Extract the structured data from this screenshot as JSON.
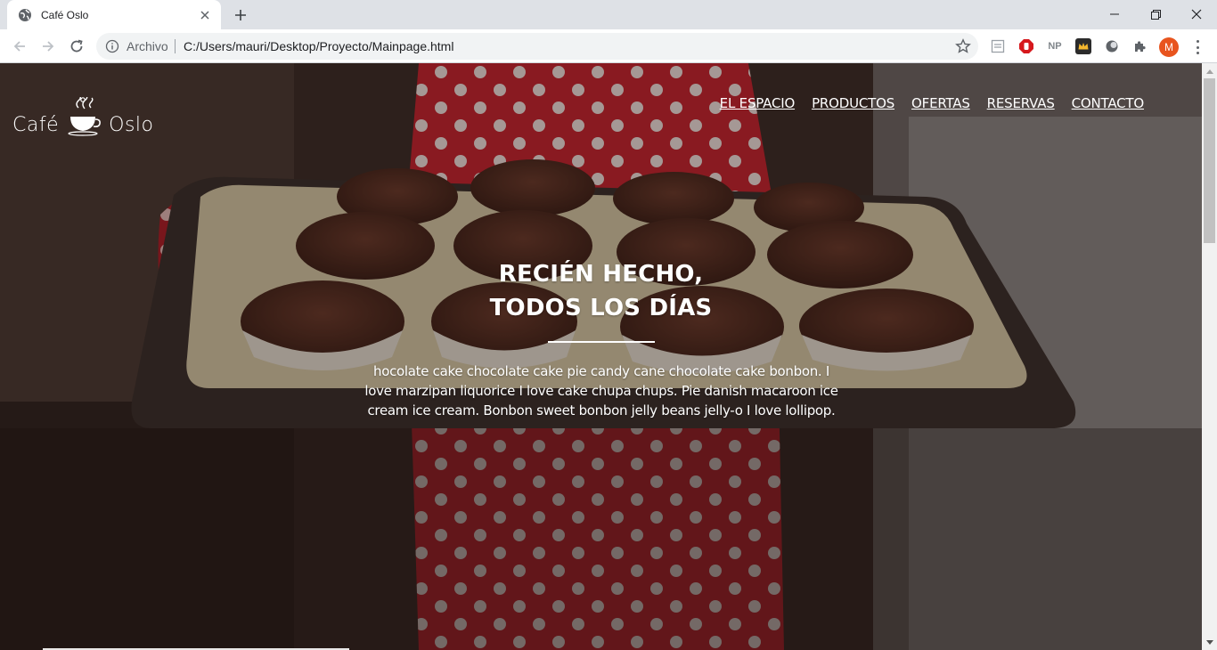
{
  "browser": {
    "tab_title": "Café Oslo",
    "url_scheme_label": "Archivo",
    "url": "C:/Users/mauri/Desktop/Proyecto/Mainpage.html",
    "extensions": [
      "NP"
    ],
    "profile_initial": "M"
  },
  "site": {
    "logo_left": "Café",
    "logo_right": "Oslo",
    "nav": [
      {
        "label": "EL ESPACIO"
      },
      {
        "label": "PRODUCTOS"
      },
      {
        "label": "OFERTAS"
      },
      {
        "label": "RESERVAS"
      },
      {
        "label": "CONTACTO"
      }
    ],
    "headline_line1": "RECIÉN HECHO,",
    "headline_line2": "TODOS LOS DÍAS",
    "lede": "hocolate cake chocolate cake pie candy cane chocolate cake bonbon. I love marzipan liquorice I love cake chupa chups. Pie danish macaroon ice cream ice cream. Bonbon sweet bonbon jelly beans jelly-o I love lollipop."
  },
  "colors": {
    "tabstrip": "#dee1e6",
    "apron_red": "#c8232e",
    "muffin": "#5a2e22",
    "tray": "#d9cba8",
    "profile": "#e8541e"
  }
}
